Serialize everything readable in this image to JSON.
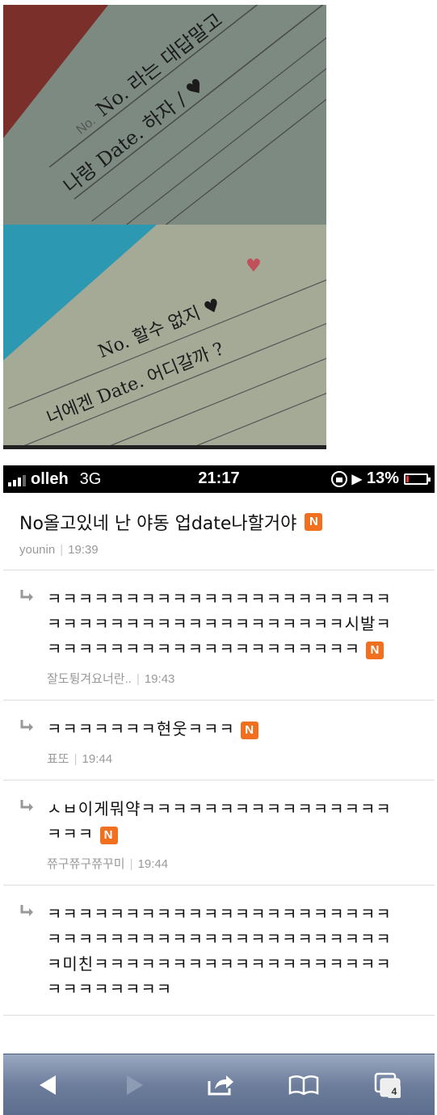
{
  "photo": {
    "top_card": {
      "line1": "No. 라는 대답말고",
      "line2": "나랑 Date. 하자 / ♥",
      "no_label": "No.",
      "date_label": "Date."
    },
    "bottom_card": {
      "line1": "No. 할수 없지 ♥",
      "line2": "너에겐 Date. 어디갈까 ?",
      "no_label": "No.",
      "date_label": "Date."
    }
  },
  "status_bar": {
    "carrier": "olleh",
    "network": "3G",
    "time": "21:17",
    "battery": "13%",
    "battery_level": 0.13
  },
  "post": {
    "title": "No올고있네 난 야동 업date나할거야",
    "badge": "N",
    "author": "younin",
    "time": "19:39"
  },
  "replies": [
    {
      "text": "ㅋㅋㅋㅋㅋㅋㅋㅋㅋㅋㅋㅋㅋㅋㅋㅋㅋㅋㅋㅋㅋㅋㅋㅋㅋㅋㅋㅋㅋㅋㅋㅋㅋㅋㅋㅋㅋㅋㅋㅋㅋ시발ㅋㅋㅋㅋㅋㅋㅋㅋㅋㅋㅋㅋㅋㅋㅋㅋㅋㅋㅋㅋㅋ",
      "badge": "N",
      "author": "잘도튕겨요너란..",
      "time": "19:43"
    },
    {
      "text": "ㅋㅋㅋㅋㅋㅋㅋ현웃ㅋㅋㅋ",
      "badge": "N",
      "author": "표또",
      "time": "19:44"
    },
    {
      "text": "ㅅㅂ이게뭐약ㅋㅋㅋㅋㅋㅋㅋㅋㅋㅋㅋㅋㅋㅋㅋㅋㅋㅋㅋ",
      "badge": "N",
      "author": "쮸구쮸구쮸꾸미",
      "time": "19:44"
    },
    {
      "text": "ㅋㅋㅋㅋㅋㅋㅋㅋㅋㅋㅋㅋㅋㅋㅋㅋㅋㅋㅋㅋㅋㅋㅋㅋㅋㅋㅋㅋㅋㅋㅋㅋㅋㅋㅋㅋㅋㅋㅋㅋㅋㅋㅋㅋㅋ미친ㅋㅋㅋㅋㅋㅋㅋㅋㅋㅋㅋㅋㅋㅋㅋㅋㅋㅋㅋㅋㅋㅋㅋㅋㅋㅋㅋ",
      "badge": "",
      "author": "",
      "time": ""
    }
  ],
  "toolbar": {
    "tab_count": "4",
    "icons": [
      "back-arrow-icon",
      "forward-arrow-icon",
      "share-icon",
      "bookmarks-icon",
      "tabs-icon"
    ]
  }
}
